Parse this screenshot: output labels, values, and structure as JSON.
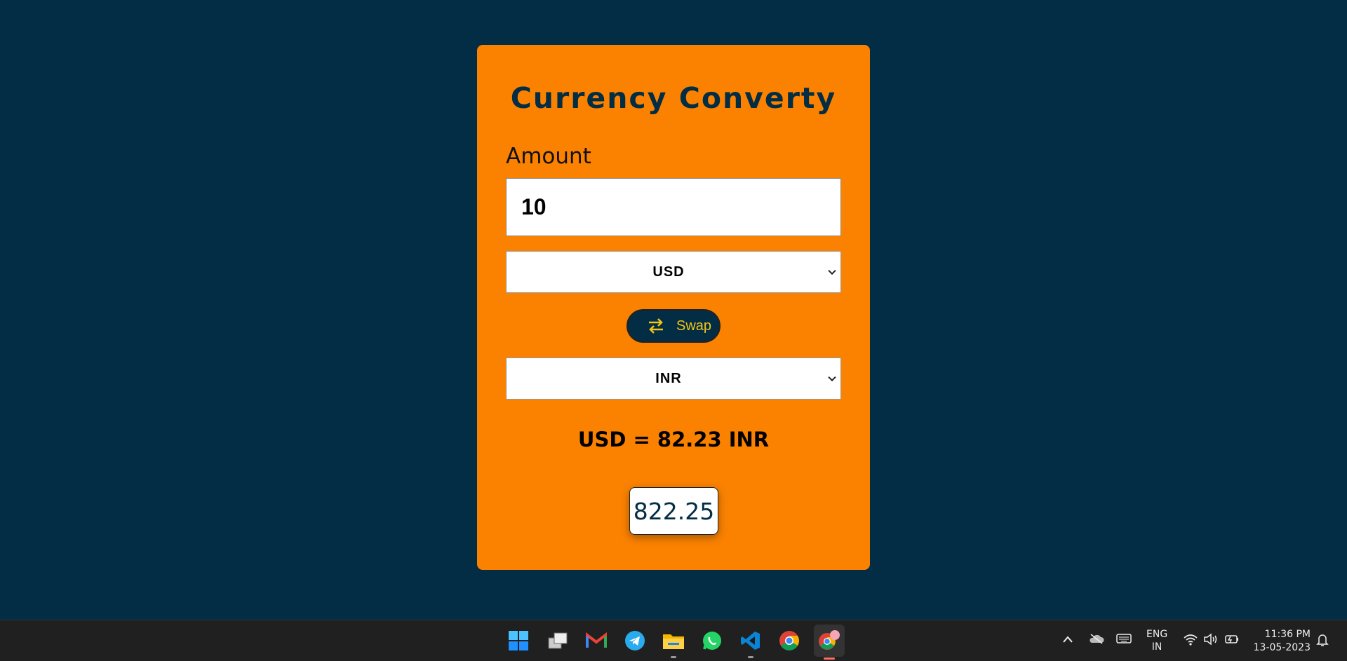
{
  "app": {
    "title": "Currency Converty",
    "amount_label": "Amount",
    "amount_value": "10",
    "from_currency": "USD",
    "to_currency": "INR",
    "swap_label": "Swap",
    "rate_text": "USD = 82.23 INR",
    "result_value": "822.25"
  },
  "colors": {
    "background": "#022d44",
    "card": "#fb8200",
    "swap_text": "#f5c518"
  },
  "taskbar": {
    "apps": [
      "windows-start-icon",
      "task-view-icon",
      "gmail-icon",
      "telegram-icon",
      "file-explorer-icon",
      "whatsapp-icon",
      "vscode-icon",
      "chrome-icon",
      "chrome-profile-icon"
    ],
    "lang_line1": "ENG",
    "lang_line2": "IN",
    "time": "11:36 PM",
    "date": "13-05-2023"
  }
}
